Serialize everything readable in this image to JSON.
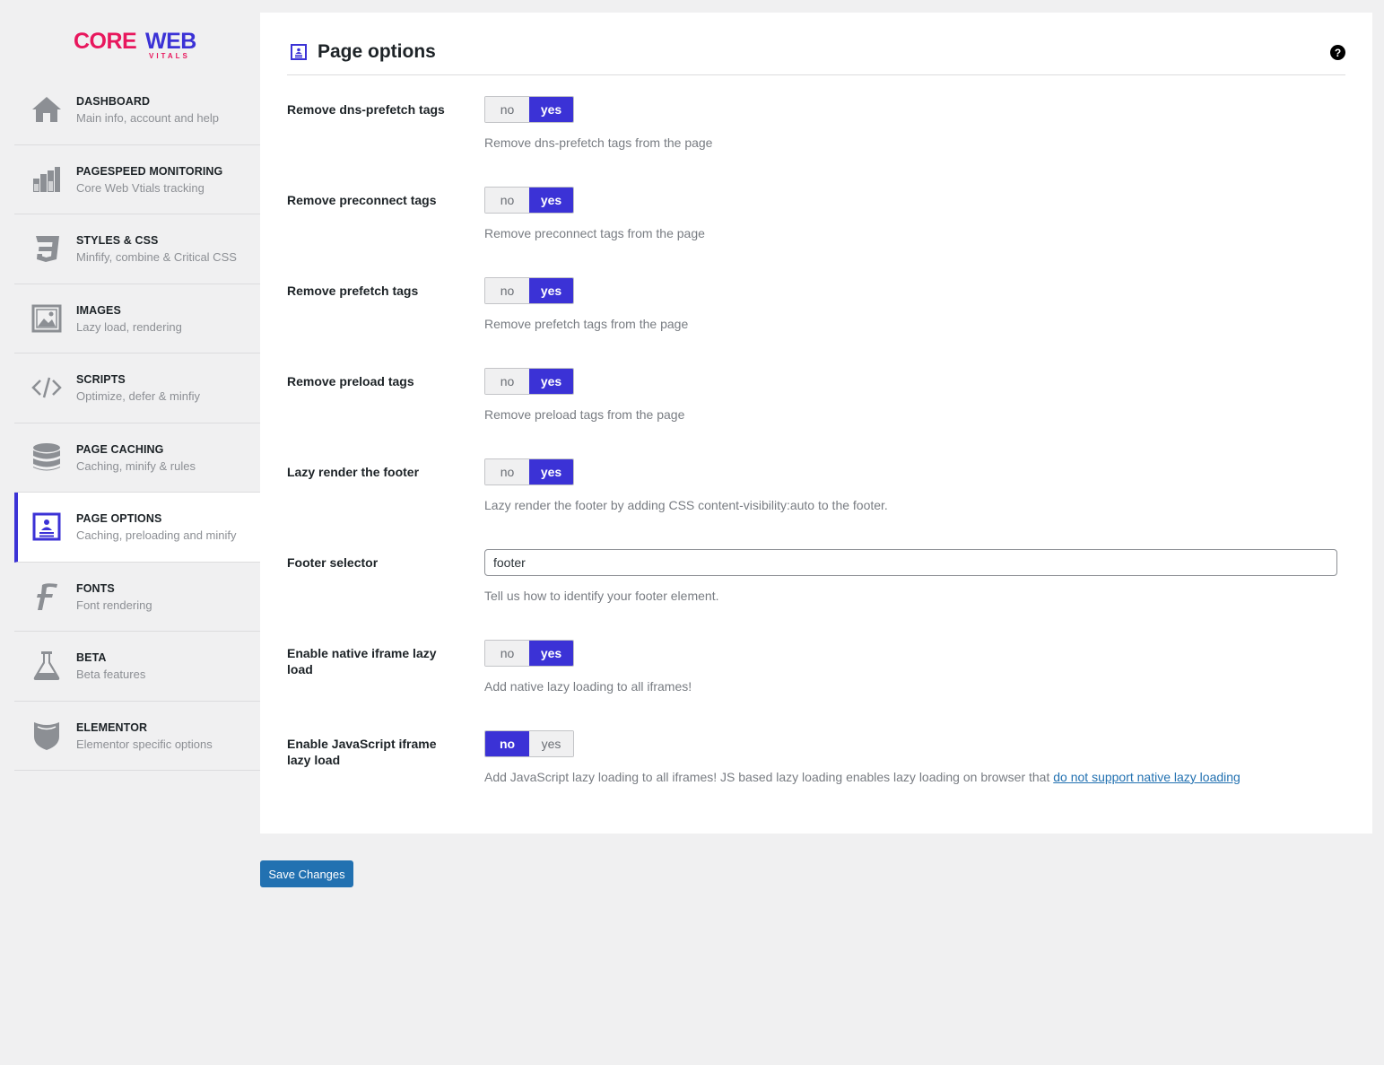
{
  "brand": {
    "logo_core": "CORE",
    "logo_web": "WEB",
    "logo_vitals": "VITALS",
    "colors": {
      "pink": "#e8175d",
      "blue": "#3b32d6"
    }
  },
  "sidebar": {
    "items": [
      {
        "title": "DASHBOARD",
        "sub": "Main info, account and help",
        "icon": "home-icon"
      },
      {
        "title": "PAGESPEED MONITORING",
        "sub": "Core Web Vtials tracking",
        "icon": "bar-chart-icon"
      },
      {
        "title": "STYLES & CSS",
        "sub": "Minfify, combine & Critical CSS",
        "icon": "css3-icon"
      },
      {
        "title": "IMAGES",
        "sub": "Lazy load, rendering",
        "icon": "image-icon"
      },
      {
        "title": "SCRIPTS",
        "sub": "Optimize, defer & minfiy",
        "icon": "code-icon"
      },
      {
        "title": "PAGE CACHING",
        "sub": "Caching, minify & rules",
        "icon": "database-icon"
      },
      {
        "title": "PAGE OPTIONS",
        "sub": "Caching, preloading and minify",
        "icon": "page-options-icon",
        "active": true
      },
      {
        "title": "FONTS",
        "sub": "Font rendering",
        "icon": "font-icon"
      },
      {
        "title": "BETA",
        "sub": "Beta features",
        "icon": "flask-icon"
      },
      {
        "title": "ELEMENTOR",
        "sub": "Elementor specific options",
        "icon": "elementor-icon"
      }
    ]
  },
  "panel": {
    "title": "Page options",
    "help": "?"
  },
  "toggle_labels": {
    "no": "no",
    "yes": "yes"
  },
  "settings": [
    {
      "label": "Remove dns-prefetch tags",
      "value": "yes",
      "desc": "Remove dns-prefetch tags from the page"
    },
    {
      "label": "Remove preconnect tags",
      "value": "yes",
      "desc": "Remove preconnect tags from the page"
    },
    {
      "label": "Remove prefetch tags",
      "value": "yes",
      "desc": "Remove prefetch tags from the page"
    },
    {
      "label": "Remove preload tags",
      "value": "yes",
      "desc": "Remove preload tags from the page"
    },
    {
      "label": "Lazy render the footer",
      "value": "yes",
      "desc": "Lazy render the footer by adding CSS content-visibility:auto to the footer."
    },
    {
      "label": "Footer selector",
      "input_value": "footer",
      "desc": "Tell us how to identify your footer element."
    },
    {
      "label": "Enable native iframe lazy load",
      "value": "yes",
      "desc": "Add native lazy loading to all iframes!"
    },
    {
      "label": "Enable JavaScript iframe lazy load",
      "value": "no",
      "desc": "Add JavaScript lazy loading to all iframes! JS based lazy loading enables lazy loading on browser that ",
      "link": "do not support native lazy loading"
    }
  ],
  "save_label": "Save Changes"
}
